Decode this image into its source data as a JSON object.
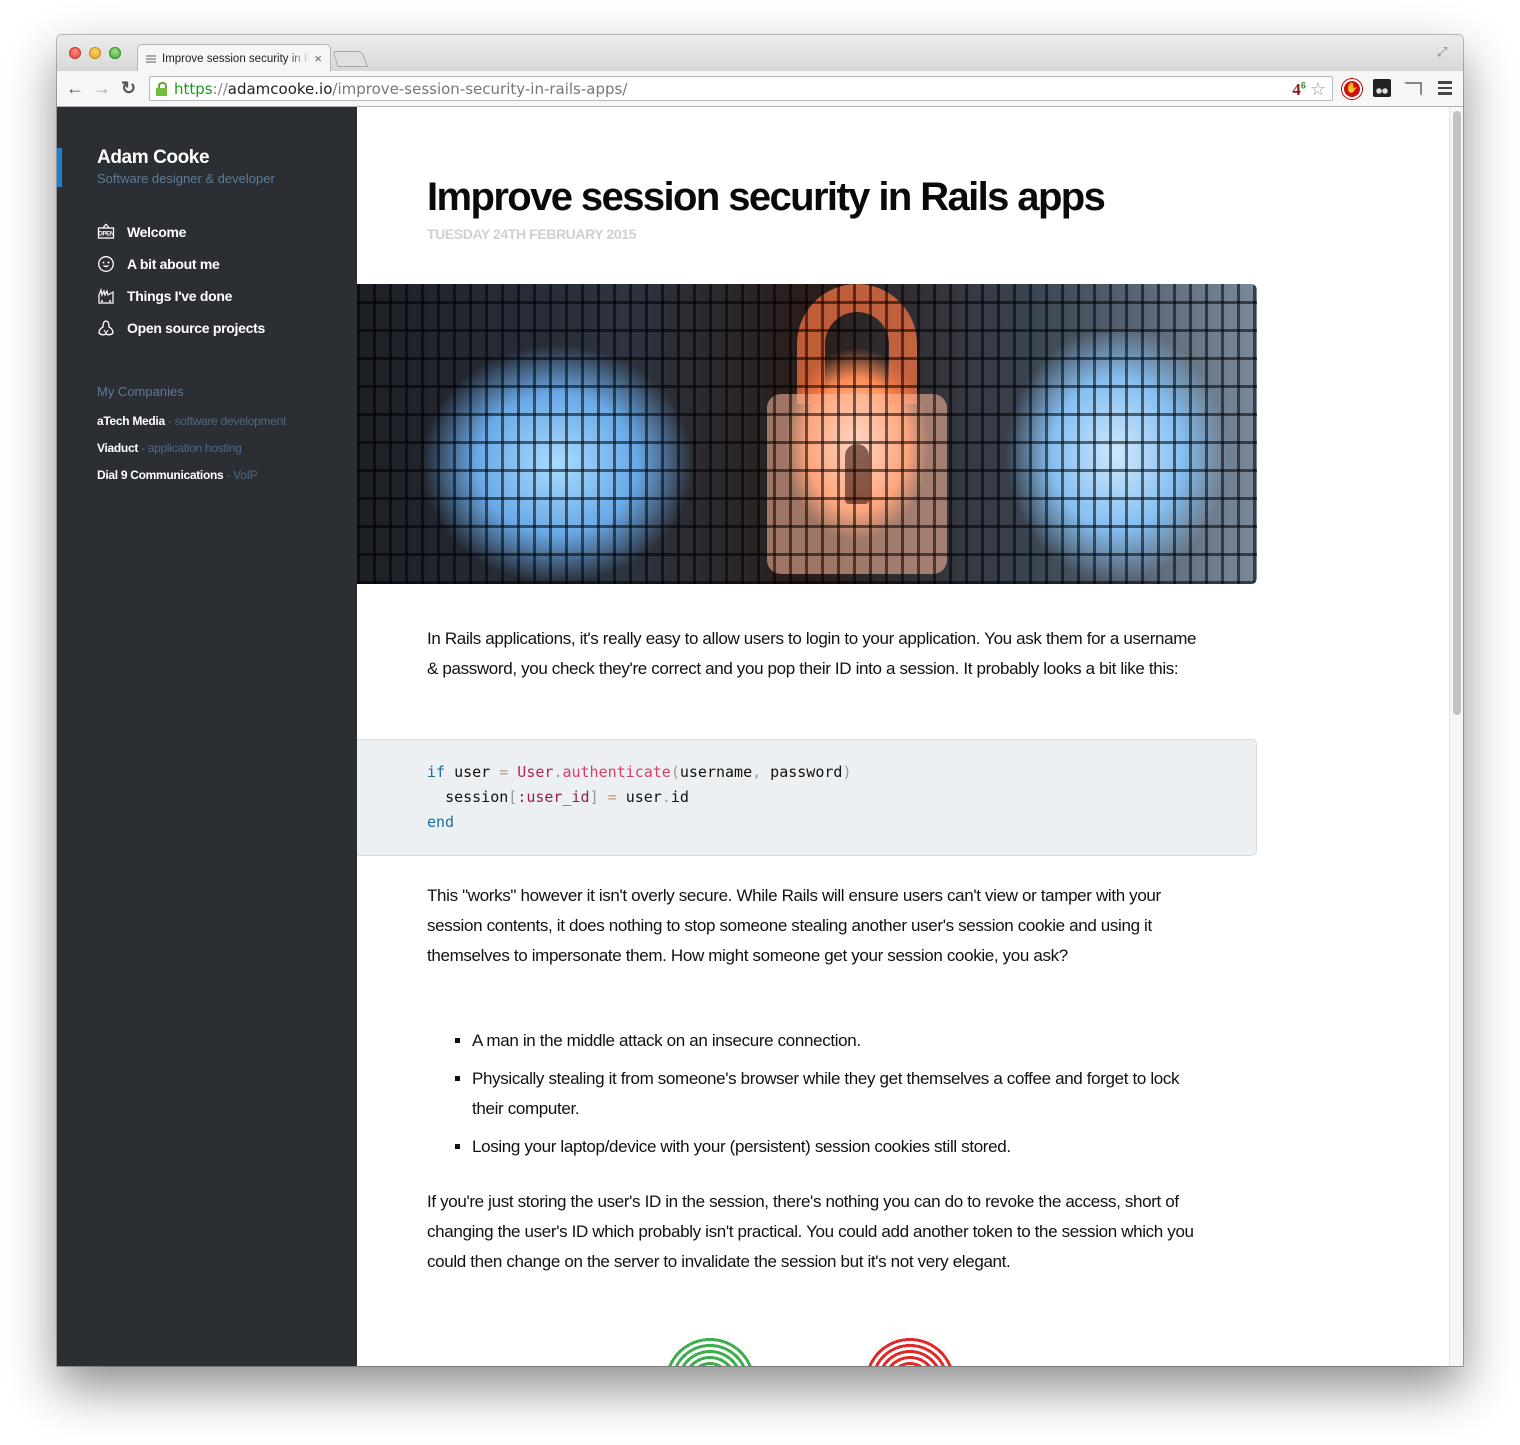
{
  "browser": {
    "tab_title": "Improve session security in Rails apps",
    "tab_close": "×",
    "url": {
      "scheme": "https",
      "separator": "://",
      "host": "adamcooke.io",
      "path": "/improve-session-security-in-rails-apps/"
    },
    "extension_badge": {
      "main": "4",
      "sup": "6"
    },
    "icons": [
      "back-arrow",
      "forward-arrow",
      "reload",
      "lock",
      "star",
      "adblock",
      "ghostery",
      "cast",
      "menu",
      "fullscreen"
    ]
  },
  "sidebar": {
    "name": "Adam Cooke",
    "tagline": "Software designer & developer",
    "accent_color": "#1d7fd1",
    "nav": [
      {
        "label": "Welcome",
        "icon": "open-sign-icon"
      },
      {
        "label": "A bit about me",
        "icon": "face-icon"
      },
      {
        "label": "Things I've done",
        "icon": "factory-icon"
      },
      {
        "label": "Open source projects",
        "icon": "octocat-icon"
      }
    ],
    "companies_title": "My Companies",
    "companies": [
      {
        "name": "aTech Media",
        "desc": " - software development"
      },
      {
        "name": "Viaduct",
        "desc": " - application hosting"
      },
      {
        "name": "Dial 9 Communications",
        "desc": " - VoIP"
      }
    ]
  },
  "article": {
    "title": "Improve session security in Rails apps",
    "date": "TUESDAY 24TH FEBRUARY 2015",
    "paragraph1": "In Rails applications, it's really easy to allow users to login to your application. You ask them for a username & password, you check they're correct and you pop their ID into a session. It probably looks a bit like this:",
    "code": {
      "line1": {
        "kw": "if",
        "var": " user ",
        "op": "=",
        "const": " User",
        "dot": ".",
        "meth": "authenticate",
        "open": "(",
        "arg1": "username",
        "comma": ",",
        "arg2": " password",
        "close": ")"
      },
      "line2": {
        "indent": "  ",
        "var": "session",
        "lb": "[",
        "sym": ":user_id",
        "rb": "]",
        "op": " = ",
        "recv": "user",
        "dot": ".",
        "attr": "id"
      },
      "line3": {
        "kw": "end"
      }
    },
    "paragraph2": "This \"works\" however it isn't overly secure. While Rails will ensure users can't view or tamper with your session contents, it does nothing to stop someone stealing another user's session cookie and using it themselves to impersonate them. How might someone get your session cookie, you ask?",
    "bullets": [
      "A man in the middle attack on an insecure connection.",
      "Physically stealing it from someone's browser while they get themselves a coffee and forget to lock their computer.",
      "Losing your laptop/device with your (persistent) session cookies still stored."
    ],
    "paragraph3": "If you're just storing the user's ID in the session, there's nothing you can do to revoke the access, short of changing the user's ID which probably isn't practical. You could add another token to the session which you could then change on the server to invalidate the session but it's not very elegant."
  }
}
